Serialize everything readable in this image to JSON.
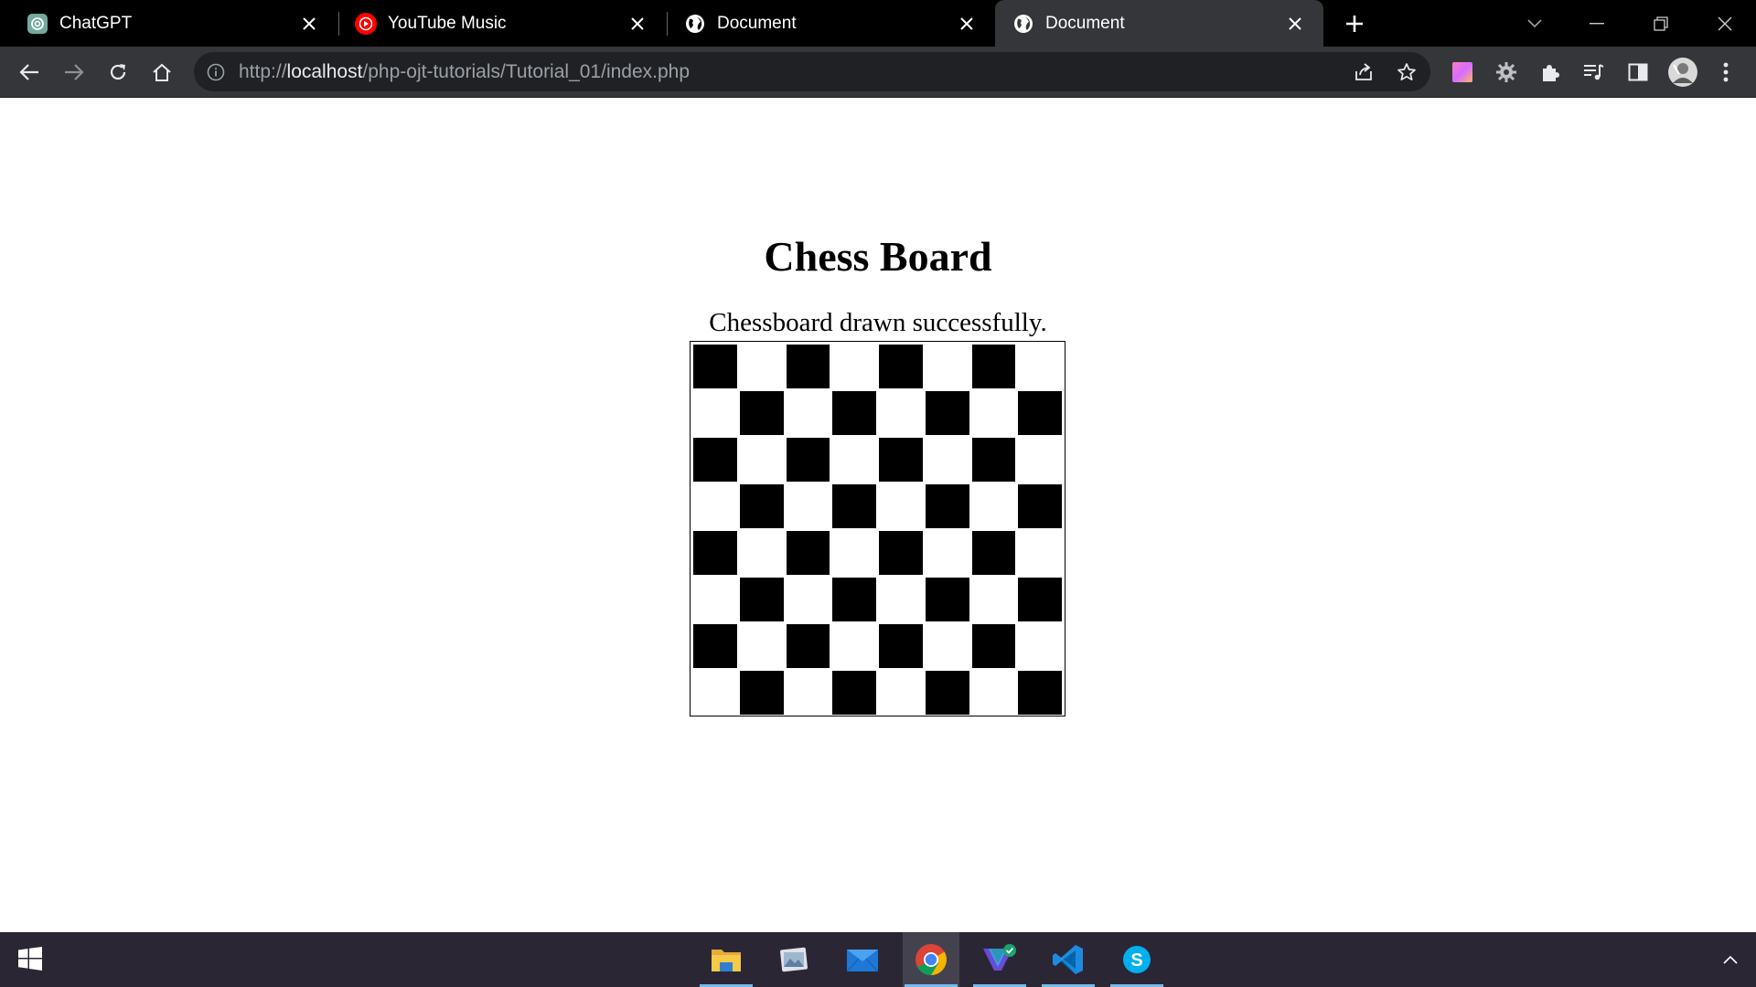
{
  "browser": {
    "tabs": [
      {
        "title": "ChatGPT",
        "icon": "chatgpt-icon",
        "active": false
      },
      {
        "title": "YouTube Music",
        "icon": "youtube-music-icon",
        "active": false
      },
      {
        "title": "Document",
        "icon": "globe-icon",
        "active": false
      },
      {
        "title": "Document",
        "icon": "globe-icon",
        "active": true
      }
    ],
    "address_bar": {
      "scheme": "http://",
      "host": "localhost",
      "path": "/php-ojt-tutorials/Tutorial_01/index.php"
    }
  },
  "page": {
    "title": "Chess Board",
    "status_message": "Chessboard drawn successfully.",
    "chessboard": {
      "rows": 8,
      "cols": 8,
      "top_left_square": "dark",
      "dark_color": "#000000",
      "light_color": "#ffffff"
    }
  },
  "taskbar": {
    "apps": [
      {
        "name": "file-explorer",
        "active": false,
        "running": true
      },
      {
        "name": "photos-viewer",
        "active": false,
        "running": false
      },
      {
        "name": "mail",
        "active": false,
        "running": false
      },
      {
        "name": "chrome",
        "active": true,
        "running": true
      },
      {
        "name": "vscode-insiders",
        "active": false,
        "running": true
      },
      {
        "name": "vscode",
        "active": false,
        "running": true
      },
      {
        "name": "skype",
        "active": false,
        "running": true
      }
    ]
  },
  "colors": {
    "tabstrip_bg": "#000000",
    "active_tab_bg": "#35363a",
    "toolbar_bg": "#35363a",
    "omnibox_bg": "#202124",
    "taskbar_bg": "#2a2634",
    "taskbar_accent": "#76b9ed"
  }
}
